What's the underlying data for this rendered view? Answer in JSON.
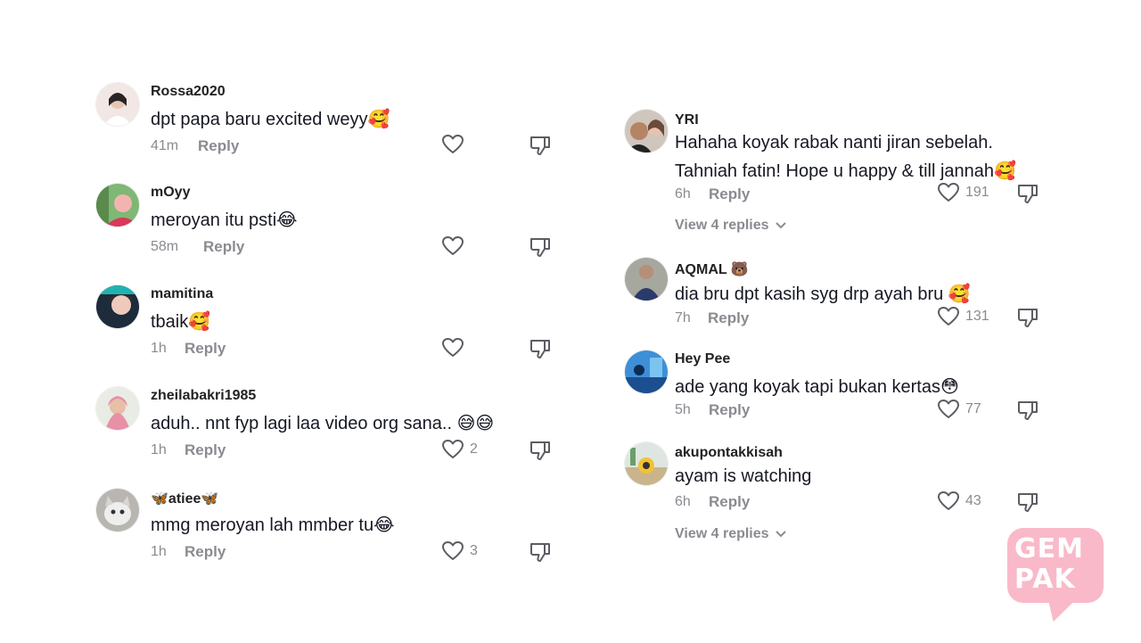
{
  "left_column": [
    {
      "username": "Rossa2020",
      "text": "dpt papa baru excited weyy🥰",
      "time": "41m",
      "reply": "Reply",
      "likes": ""
    },
    {
      "username": "mOyy",
      "text": "meroyan itu psti😂",
      "time": "58m",
      "reply": "Reply",
      "likes": ""
    },
    {
      "username": "mamitina",
      "text": "tbaik🥰",
      "time": "1h",
      "reply": "Reply",
      "likes": ""
    },
    {
      "username": "zheilabakri1985",
      "text": "aduh.. nnt fyp lagi laa video org sana.. 😅😅",
      "time": "1h",
      "reply": "Reply",
      "likes": "2"
    },
    {
      "username": "🦋atiee🦋",
      "text": "mmg meroyan lah mmber tu😂",
      "time": "1h",
      "reply": "Reply",
      "likes": "3"
    }
  ],
  "right_column": [
    {
      "username": "YRI",
      "text": "Hahaha koyak rabak nanti jiran sebelah.",
      "text2": "Tahniah fatin! Hope u happy & till jannah🥰",
      "time": "6h",
      "reply": "Reply",
      "likes": "191",
      "view_replies": "View 4 replies"
    },
    {
      "username": "AQMAL 🐻",
      "text": "dia bru dpt kasih syg drp ayah bru 🥰",
      "time": "7h",
      "reply": "Reply",
      "likes": "131"
    },
    {
      "username": "Hey Pee",
      "text": "ade yang koyak tapi bukan kertas😳",
      "time": "5h",
      "reply": "Reply",
      "likes": "77"
    },
    {
      "username": "akupontakkisah",
      "text": "ayam is watching",
      "time": "6h",
      "reply": "Reply",
      "likes": "43",
      "view_replies": "View 4 replies"
    }
  ],
  "logo": {
    "line1": "GEM",
    "line2": "PAK"
  },
  "colors": {
    "text": "#161823",
    "muted": "#8a8b91",
    "logo": "#f9b9c9"
  }
}
